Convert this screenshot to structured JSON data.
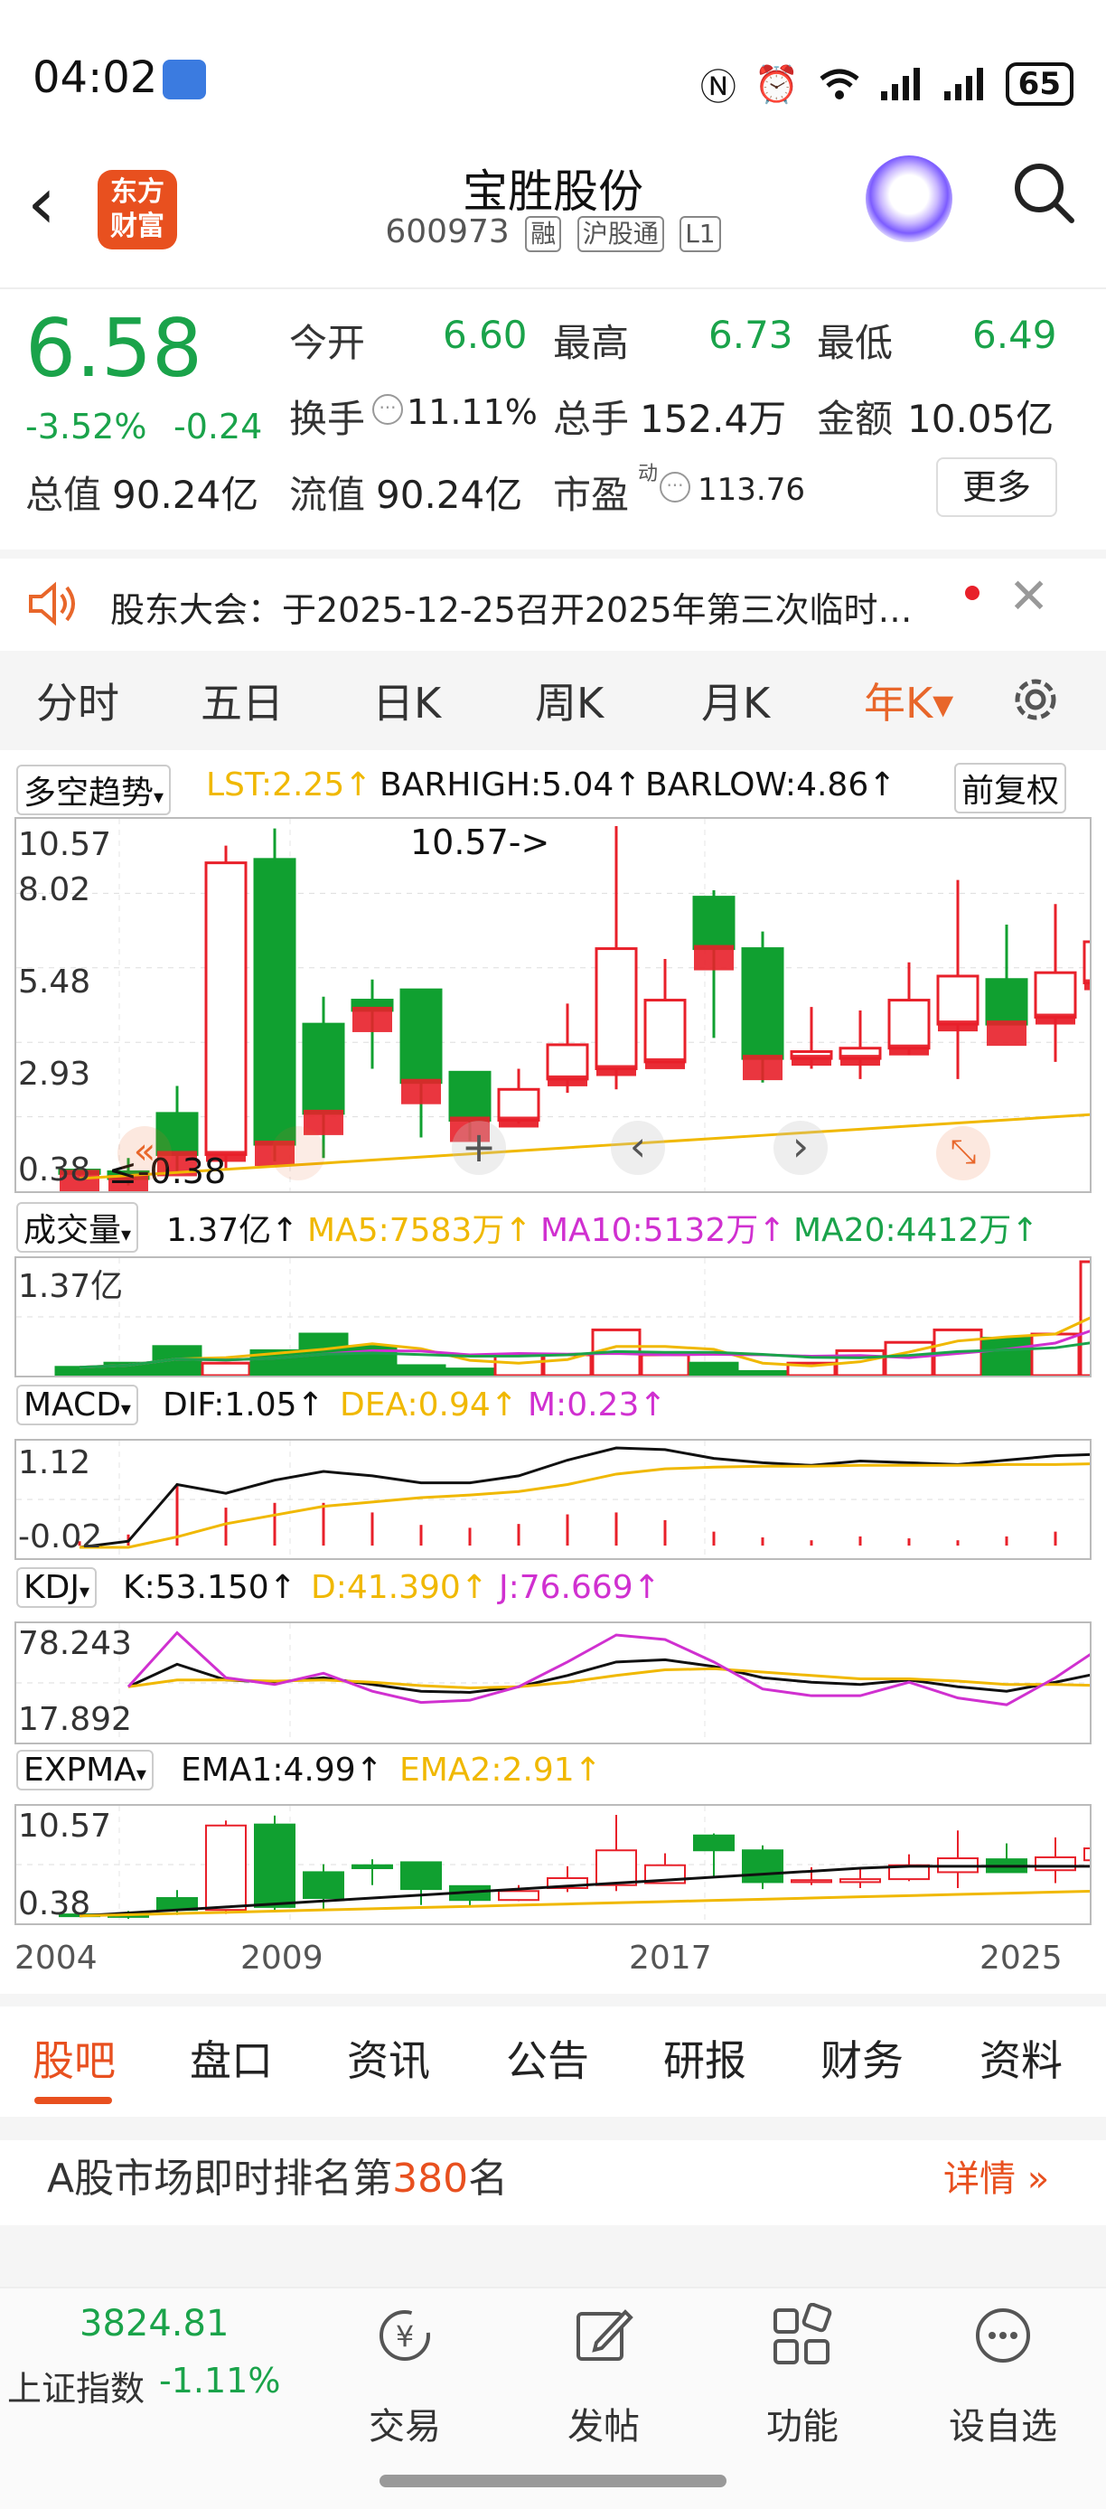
{
  "status_bar": {
    "time": "04:02",
    "battery": "65",
    "icons": [
      "nfc-icon",
      "alarm-icon",
      "wifi-icon",
      "signal-icon",
      "signal-icon"
    ]
  },
  "header": {
    "logo_line1": "东方",
    "logo_line2": "财富",
    "title": "宝胜股份",
    "code": "600973",
    "tags": [
      "融",
      "沪股通",
      "L1"
    ]
  },
  "quote": {
    "price": "6.58",
    "change_pct": "-3.52%",
    "change": "-0.24",
    "open_label": "今开",
    "open": "6.60",
    "high_label": "最高",
    "high": "6.73",
    "low_label": "最低",
    "low": "6.49",
    "turnover_label": "换手",
    "turnover": "11.11%",
    "volume_label": "总手",
    "volume": "152.4万",
    "amount_label": "金额",
    "amount": "10.05亿",
    "mktcap_label": "总值",
    "mktcap": "90.24亿",
    "float_label": "流值",
    "float_cap": "90.24亿",
    "pe_label": "市盈",
    "pe_sup": "动",
    "pe": "113.76",
    "more": "更多"
  },
  "notice": {
    "text": "股东大会：于2025-12-25召开2025年第三次临时…"
  },
  "period_tabs": [
    "分时",
    "五日",
    "日K",
    "周K",
    "月K",
    "年K▾"
  ],
  "active_period": "年K▾",
  "colors": {
    "up": "#e8202a",
    "down": "#10a030",
    "accent": "#e8662a",
    "ma_yellow": "#f0b800",
    "ma_magenta": "#d030d0",
    "ma_green": "#1aa34a"
  },
  "main_indicator": {
    "name": "多空趋势",
    "lst": "LST:2.25↑",
    "barhigh": "BARHIGH:5.04↑",
    "barlow": "BARLOW:4.86↑",
    "adjust": "前复权",
    "y_labels": [
      "10.57",
      "8.02",
      "5.48",
      "2.93",
      "0.38"
    ],
    "max_marker": "10.57->",
    "min_marker": "≤-0.38"
  },
  "volume_indicator": {
    "name": "成交量",
    "value": "1.37亿↑",
    "ma5": "MA5:7583万↑",
    "ma10": "MA10:5132万↑",
    "ma20": "MA20:4412万↑",
    "y_label": "1.37亿"
  },
  "macd": {
    "name": "MACD",
    "dif": "DIF:1.05↑",
    "dea": "DEA:0.94↑",
    "m": "M:0.23↑",
    "y_top": "1.12",
    "y_bottom": "-0.02"
  },
  "kdj": {
    "name": "KDJ",
    "k": "K:53.150↑",
    "d": "D:41.390↑",
    "j": "J:76.669↑",
    "y_top": "78.243",
    "y_bottom": "17.892"
  },
  "expma": {
    "name": "EXPMA",
    "ema1": "EMA1:4.99↑",
    "ema2": "EMA2:2.91↑",
    "y_top": "10.57",
    "y_bottom": "0.38"
  },
  "x_axis": [
    "2004",
    "2009",
    "2017",
    "2025"
  ],
  "chart_data": {
    "type": "candlestick",
    "title": "",
    "period": "yearly",
    "years": [
      "2004",
      "2005",
      "2006",
      "2007",
      "2008",
      "2009",
      "2010",
      "2011",
      "2012",
      "2013",
      "2014",
      "2015",
      "2016",
      "2017",
      "2018",
      "2019",
      "2020",
      "2021",
      "2022",
      "2023",
      "2024",
      "2025"
    ],
    "open": [
      0.55,
      0.5,
      2.2,
      1.0,
      9.6,
      4.8,
      5.5,
      5.8,
      3.4,
      2.0,
      3.2,
      3.5,
      3.7,
      8.5,
      7.0,
      3.8,
      3.8,
      4.1,
      4.8,
      6.1,
      5.0,
      6.0
    ],
    "close": [
      0.45,
      0.3,
      1.0,
      9.5,
      1.3,
      2.2,
      5.2,
      3.1,
      2.0,
      2.9,
      4.2,
      7.0,
      5.5,
      7.0,
      3.8,
      4.0,
      4.1,
      5.5,
      6.2,
      4.8,
      6.3,
      7.2
    ],
    "high": [
      0.6,
      0.9,
      3.0,
      10.0,
      10.5,
      5.6,
      6.1,
      5.6,
      2.7,
      3.5,
      5.4,
      10.57,
      6.7,
      8.7,
      7.5,
      5.3,
      5.2,
      6.6,
      9.0,
      7.7,
      8.3,
      8.1
    ],
    "low": [
      0.38,
      0.1,
      0.5,
      0.6,
      0.8,
      0.9,
      3.5,
      1.5,
      1.4,
      1.9,
      2.8,
      2.9,
      4.8,
      4.4,
      3.1,
      3.5,
      3.2,
      3.9,
      3.2,
      4.8,
      3.7,
      3.5
    ],
    "volume_yi": [
      0.1,
      0.15,
      0.35,
      0.15,
      0.3,
      0.5,
      0.35,
      0.12,
      0.08,
      0.25,
      0.25,
      0.55,
      0.25,
      0.15,
      0.05,
      0.15,
      0.3,
      0.4,
      0.55,
      0.45,
      0.5,
      1.37
    ],
    "ylim": [
      0.38,
      10.57
    ]
  },
  "bottom_tabs": [
    "股吧",
    "盘口",
    "资讯",
    "公告",
    "研报",
    "财务",
    "资料"
  ],
  "active_bottom_tab": "股吧",
  "rank": {
    "prefix": "A股市场即时排名第",
    "number": "380",
    "suffix": "名",
    "detail": "详情"
  },
  "footer": {
    "index_value": "3824.81",
    "index_name": "上证指数",
    "index_change": "-1.11%",
    "items": [
      {
        "label": "交易",
        "icon": "yuan-icon"
      },
      {
        "label": "发帖",
        "icon": "edit-icon"
      },
      {
        "label": "功能",
        "icon": "grid-icon"
      },
      {
        "label": "设自选",
        "icon": "more-icon"
      }
    ]
  }
}
